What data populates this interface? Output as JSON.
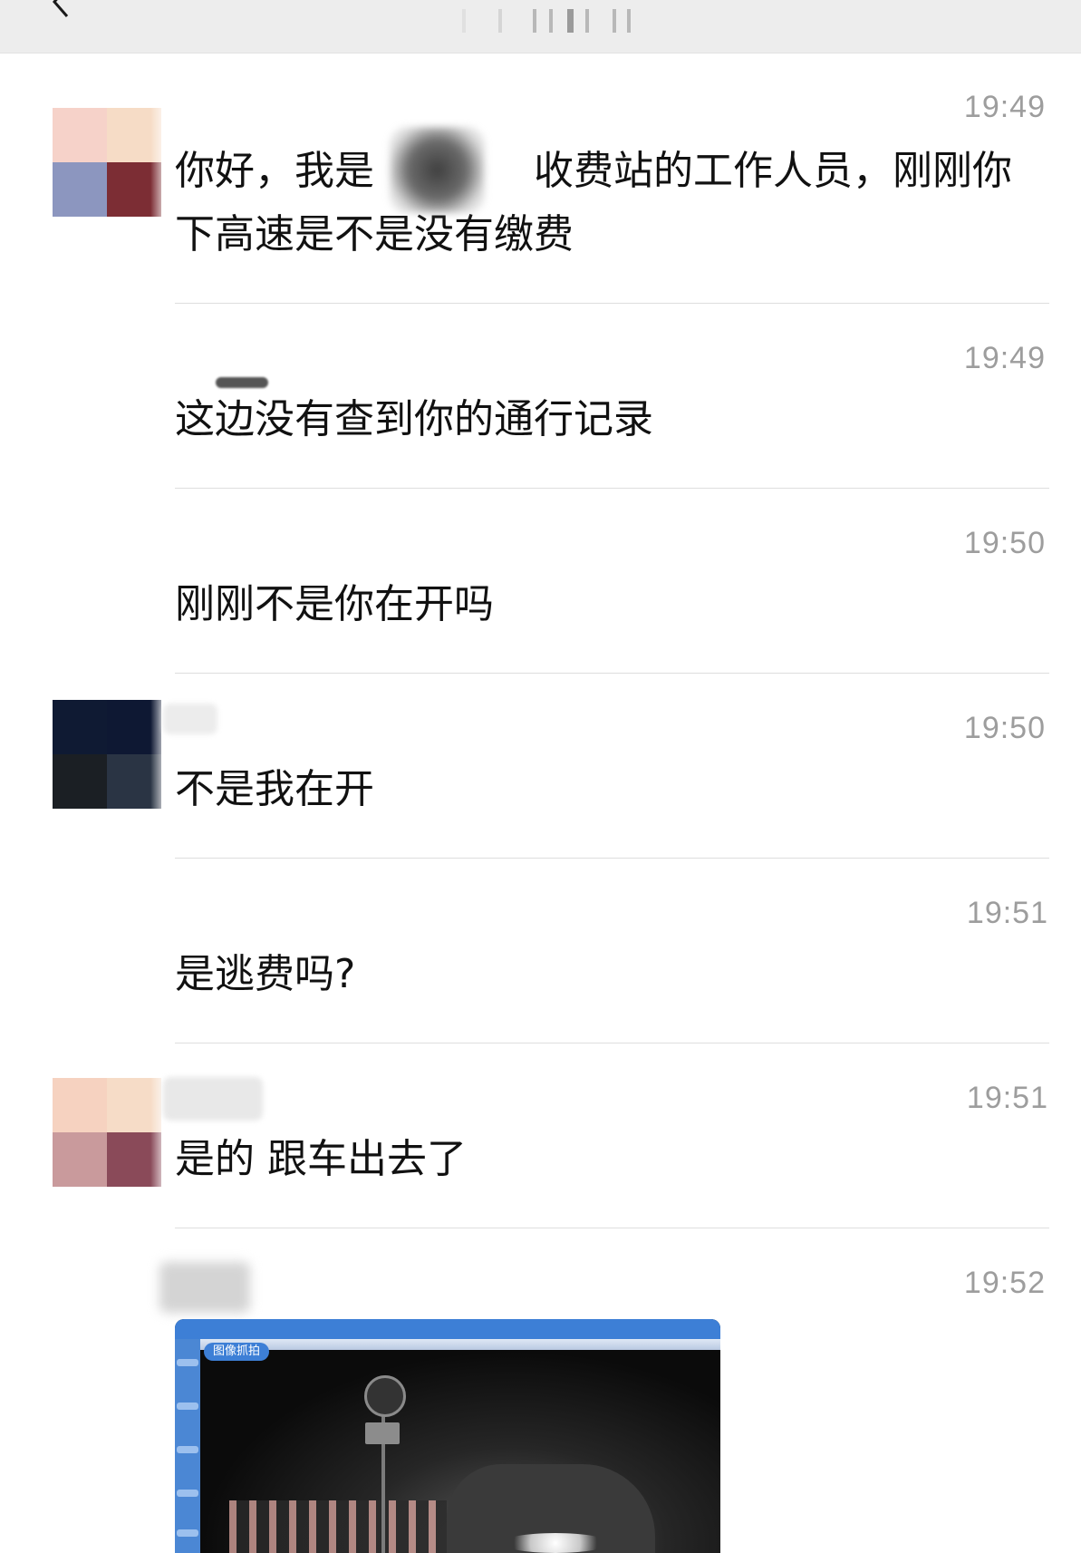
{
  "messages": [
    {
      "time": "19:49",
      "text": "你好，我是　　　　收费站的工作人员，刚刚你下高速是不是没有缴费",
      "avatar_colors": [
        "#f6d2c9",
        "#f6dcc6",
        "#8c96bf",
        "#7c2d34"
      ]
    },
    {
      "time": "19:49",
      "text": "这边没有查到你的通行记录"
    },
    {
      "time": "19:50",
      "text": "刚刚不是你在开吗"
    },
    {
      "time": "19:50",
      "text": "不是我在开",
      "avatar_colors": [
        "#0f1a33",
        "#0e1833",
        "#1b1f24",
        "#2a3444"
      ]
    },
    {
      "time": "19:51",
      "text": "是逃费吗?"
    },
    {
      "time": "19:51",
      "text": "是的 跟车出去了",
      "avatar_colors": [
        "#f6d2c0",
        "#f6dcc7",
        "#c99a9c",
        "#8a4a59"
      ]
    },
    {
      "time": "19:52",
      "image": {
        "tag": "图像抓拍",
        "description": "photo-attachment"
      }
    }
  ],
  "icons": {
    "back": "chevron-left-icon"
  }
}
